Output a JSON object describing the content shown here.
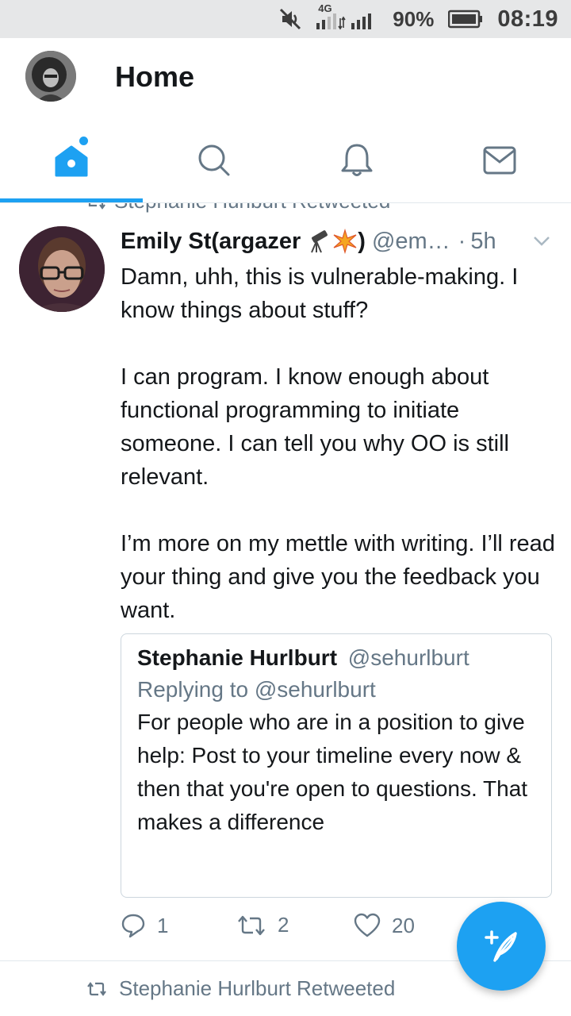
{
  "status_bar": {
    "network": "4G",
    "battery": "90%",
    "time": "08:19",
    "icons": [
      "mute-icon",
      "signal-icon",
      "battery-icon"
    ]
  },
  "header": {
    "title": "Home"
  },
  "tabs": [
    {
      "name": "home",
      "icon": "home-icon",
      "active": true
    },
    {
      "name": "search",
      "icon": "search-icon",
      "active": false
    },
    {
      "name": "notifications",
      "icon": "bell-icon",
      "active": false
    },
    {
      "name": "messages",
      "icon": "mail-icon",
      "active": false
    }
  ],
  "top_retweet_label": "Stephanie Hurlburt Retweeted",
  "tweet": {
    "name": "Emily St(argazer",
    "name_suffix": ")",
    "emoji": [
      "telescope",
      "sparkle"
    ],
    "handle": "@em…",
    "separator": "·",
    "time": "5h",
    "body": "Damn, uhh, this is vulnerable-making. I know things about stuff?\n\nI can program. I know enough about functional programming to initiate someone. I can tell you why OO is still relevant.\n\nI’m more on my mettle with writing. I’ll read your thing and give you the feedback you want.",
    "quote": {
      "name": "Stephanie Hurlburt",
      "handle": "@sehurlburt",
      "replying": "Replying to @sehurlburt",
      "body": "For people who are in a position to give help: Post to your timeline every now & then that you're open to questions. That makes a difference"
    },
    "actions": {
      "replies": "1",
      "retweets": "2",
      "likes": "20"
    }
  },
  "bottom_retweet_label": "Stephanie Hurlburt Retweeted",
  "colors": {
    "accent": "#1da1f2",
    "secondary_text": "#657786",
    "status_bar_bg": "#e6e7e8"
  }
}
